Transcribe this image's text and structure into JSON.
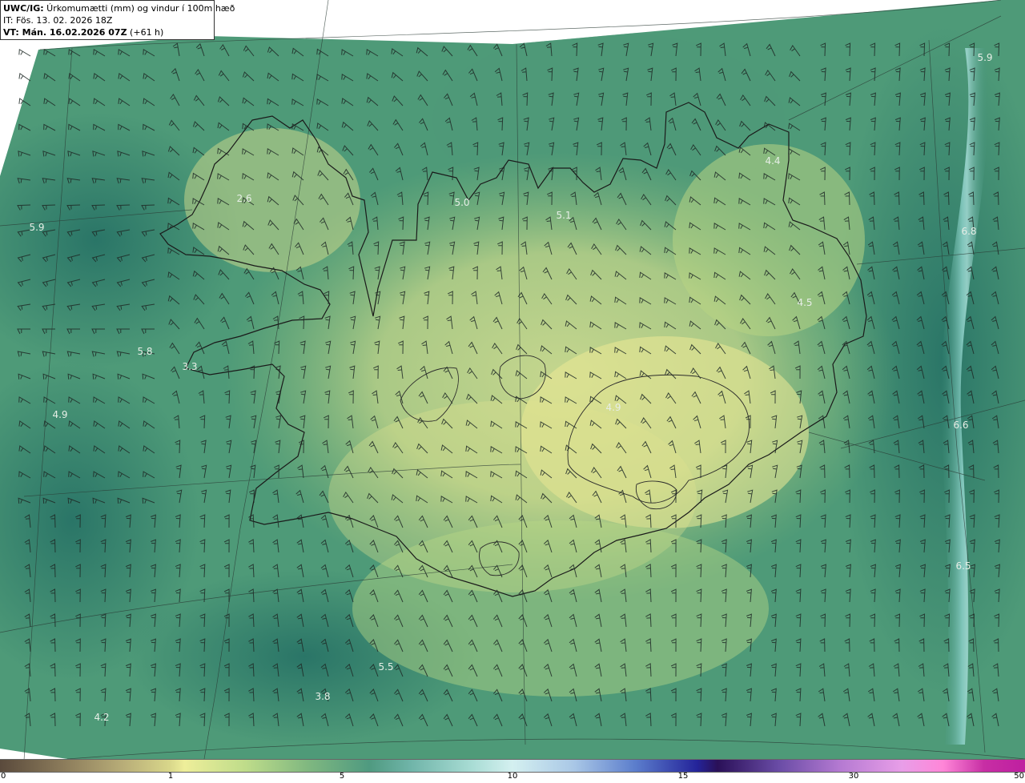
{
  "header": {
    "line1_bold": "UWC/IG:",
    "line1_rest": " Úrkomumætti (mm) og vindur í 100m hæð",
    "line2": "IT: Fös. 13. 02. 2026 18Z",
    "line3_bold": "VT: Mán. 16.02.2026 07Z",
    "line3_rest": " (+61 h)"
  },
  "map_labels": [
    {
      "text": "5.9"
    },
    {
      "text": "4.4"
    },
    {
      "text": "5.0"
    },
    {
      "text": "5.1"
    },
    {
      "text": "2.6"
    },
    {
      "text": "5.9"
    },
    {
      "text": "6.8"
    },
    {
      "text": "4.5"
    },
    {
      "text": "5.8"
    },
    {
      "text": "3.3"
    },
    {
      "text": "4.9"
    },
    {
      "text": "4.9"
    },
    {
      "text": "6.6"
    },
    {
      "text": "6.5"
    },
    {
      "text": "5.5"
    },
    {
      "text": "3.8"
    },
    {
      "text": "4.2"
    }
  ],
  "colorbar": {
    "ticks": [
      "0",
      "1",
      "5",
      "10",
      "15",
      "30",
      "50"
    ],
    "colors": [
      "#5a4a3c",
      "#eeee9a",
      "#4f9a80",
      "#d4f0f0",
      "#24249a",
      "#e89ee8",
      "#bf1fa0"
    ]
  },
  "palette": {
    "sea_dark": "#2f7d70",
    "sea": "#4e9a78",
    "land_low": "#8fbf7a",
    "land_high": "#e9e793",
    "front_band": "#7cc4bc",
    "coastline": "#1a1a1a"
  }
}
